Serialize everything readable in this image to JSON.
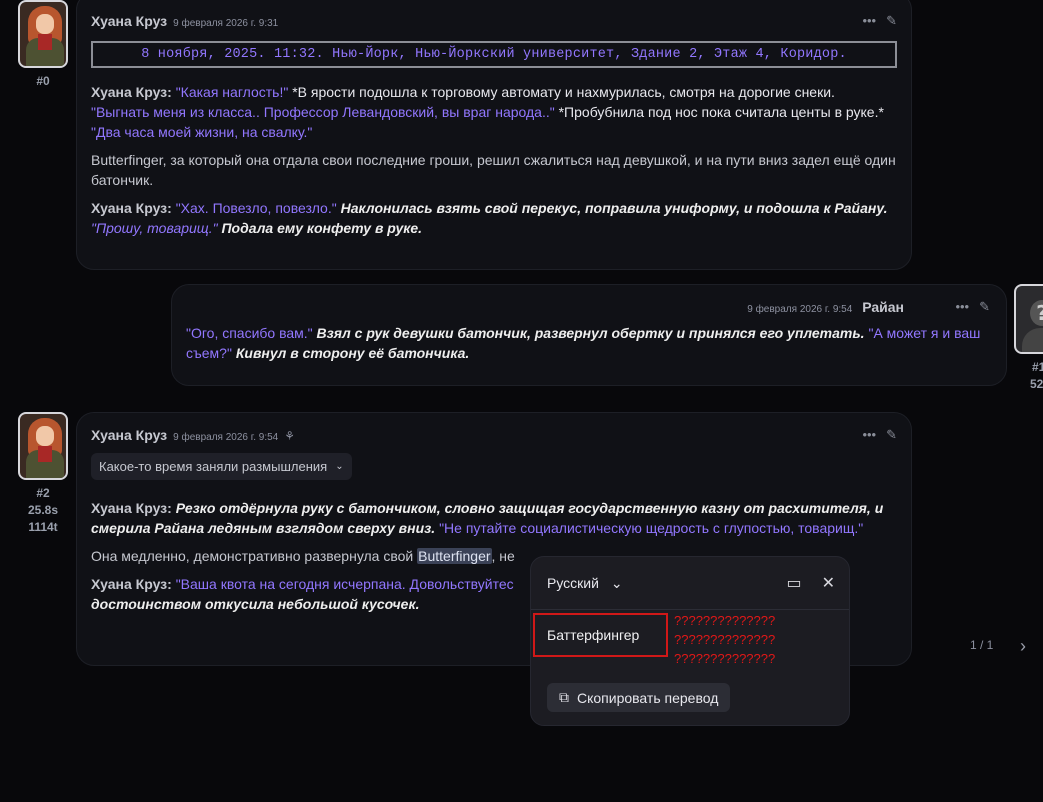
{
  "messages": [
    {
      "id": "#0",
      "author": "Хуана Круз",
      "time": "9 февраля 2026 г. 9:31",
      "location": "8 ноября, 2025. 11:32. Нью-Йорк, Нью-Йоркский университет, Здание 2, Этаж 4, Коридор.",
      "p1_name": "Хуана Круз:",
      "p1_q1": "\"Какая наглость!\"",
      "p1_a1": "*В ярости подошла к торговому автомату и нахмурилась, смотря на дорогие снеки.",
      "p1_q2": "\"Выгнать меня из класса.. Профессор Левандовский, вы враг народа..\"",
      "p1_a2": "*Пробубнила под нос пока считала центы в руке.*",
      "p1_q3": "\"Два часа моей жизни, на свалку.\"",
      "p2": "Butterfinger, за который она отдала свои последние гроши, решил сжалиться над девушкой, и на пути вниз задел ещё один батончик.",
      "p3_name": "Хуана Круз:",
      "p3_q1": "\"Хах. Повезло, повезло.\"",
      "p3_a1": "Наклонилась взять свой перекус, поправила униформу, и подошла к Райану.",
      "p3_q2": "\"Прошу, товарищ.\"",
      "p3_a2": "Подала ему конфету в руке."
    },
    {
      "id": "#1",
      "stat": "52",
      "author": "Райан",
      "time": "9 февраля 2026 г. 9:54",
      "q1": "\"Ого, спасибо вам.\"",
      "a1": "Взял с рук девушки батончик, развернул обертку и принялся его уплетать.",
      "q2": "\"А может я и ваш съем?\"",
      "a2": "Кивнул в сторону её батончика."
    },
    {
      "id": "#2",
      "duration": "25.8s",
      "tokens": "1114t",
      "author": "Хуана Круз",
      "time": "9 февраля 2026 г. 9:54",
      "thinking_label": "Какое-то время заняли размышления",
      "p1_name": "Хуана Круз:",
      "p1_a1": "Резко отдёрнула руку с батончиком, словно защищая государственную казну от расхитителя, и смерила Райана ледяным взглядом сверху вниз.",
      "p1_q1": "\"Не путайте социалистическую щедрость с глупостью, товарищ.\"",
      "p2_pre": "Она медленно, демонстративно развернула свой",
      "p2_hl": "Butterfinger",
      "p2_post": ", не",
      "p3_name": "Хуана Круз:",
      "p3_q1": "\"Ваша квота на сегодня исчерпана. Довольствуйтес",
      "p3_a1": "достоинством откусила небольшой кусочек.",
      "pager": "1 / 1"
    }
  ],
  "translate_popup": {
    "language": "Русский",
    "translation": "Баттерфингер",
    "garbled": [
      "??????????????",
      "??????????????",
      "??????????????"
    ],
    "copy_label": "Скопировать перевод"
  },
  "colors": {
    "quote": "#9277ff",
    "action": "#eeeeee",
    "highlight_error": "#d01818"
  }
}
